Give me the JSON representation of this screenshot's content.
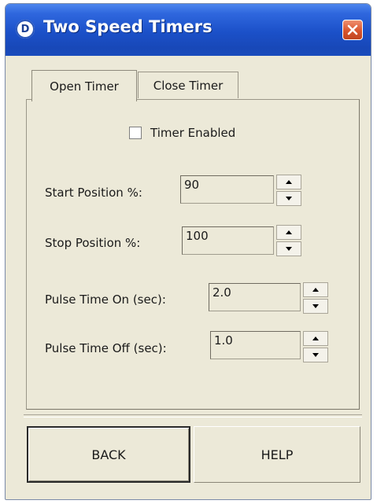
{
  "window": {
    "title": "Two Speed Timers",
    "icon_letter": "D",
    "icon": "app-icon"
  },
  "tabs": [
    {
      "label": "Open Timer",
      "active": true
    },
    {
      "label": "Close Timer",
      "active": false
    }
  ],
  "timer_enabled": {
    "label": "Timer Enabled",
    "checked": false
  },
  "fields": {
    "start_position": {
      "label": "Start Position %:",
      "value": "90"
    },
    "stop_position": {
      "label": "Stop Position %:",
      "value": "100"
    },
    "pulse_on": {
      "label": "Pulse Time On (sec):",
      "value": "2.0"
    },
    "pulse_off": {
      "label": "Pulse Time Off (sec):",
      "value": "1.0"
    }
  },
  "buttons": {
    "back": "BACK",
    "help": "HELP"
  },
  "colors": {
    "titlebar": "#1b50c8",
    "close": "#d8552e",
    "dialog_bg": "#ece9d8"
  }
}
